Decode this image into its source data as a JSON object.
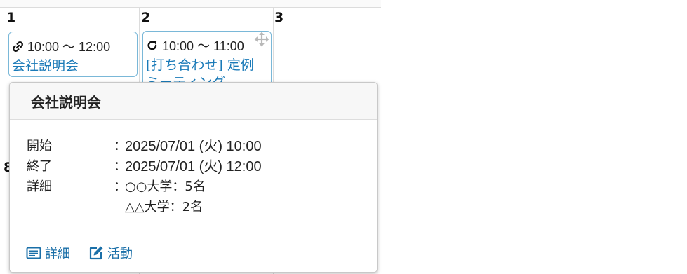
{
  "calendar": {
    "days": [
      {
        "num": "1"
      },
      {
        "num": "2"
      },
      {
        "num": "3"
      },
      {
        "num": "8"
      }
    ],
    "events": [
      {
        "time": "10:00 ～ 12:00",
        "title": "会社説明会",
        "icon": "link-icon"
      },
      {
        "time": "10:00 ～ 11:00",
        "title": "[打ち合わせ] 定例",
        "title_cont": "ミーティング",
        "icon": "repeat-icon",
        "handle_icon": "move-icon"
      }
    ]
  },
  "popover": {
    "title": "会社説明会",
    "details": [
      {
        "label": "開始",
        "sep": "：",
        "value": "2025/07/01 (火) 10:00"
      },
      {
        "label": "終了",
        "sep": "：",
        "value": "2025/07/01 (火) 12:00"
      },
      {
        "label": "詳細",
        "sep": "：",
        "value": "○○大学：5名"
      },
      {
        "label": "",
        "sep": "",
        "value": "△△大学：2名"
      }
    ],
    "actions": [
      {
        "label": "詳細",
        "icon": "list-icon"
      },
      {
        "label": "活動",
        "icon": "edit-icon"
      }
    ]
  },
  "colors": {
    "link": "#1a6fa8",
    "event_title": "#1a7ab8",
    "event_border": "#7ab8d8"
  }
}
